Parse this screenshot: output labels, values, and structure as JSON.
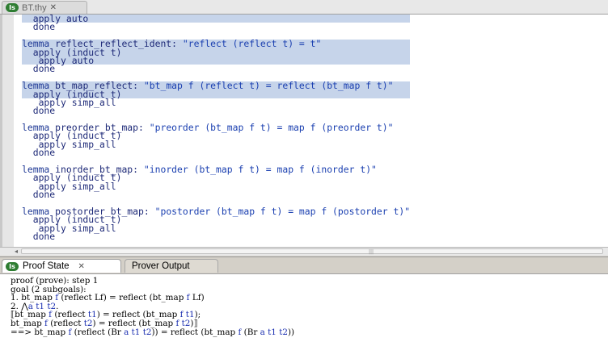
{
  "editor_tab": {
    "title": "BT.thy",
    "close_glyph": "✕",
    "icon": "isabelle-theory-icon"
  },
  "code_lines": [
    {
      "hl": true,
      "parts": [
        [
          "tk",
          "  apply auto"
        ]
      ]
    },
    {
      "hl": false,
      "parts": [
        [
          "tk",
          "  done"
        ]
      ]
    },
    {
      "hl": false,
      "parts": [
        [
          "tk",
          ""
        ]
      ]
    },
    {
      "hl": true,
      "parts": [
        [
          "kw",
          "lemma"
        ],
        [
          "tk",
          " reflect_reflect_ident: "
        ],
        [
          "str",
          "\"reflect (reflect t) = t\""
        ]
      ]
    },
    {
      "hl": true,
      "parts": [
        [
          "tk",
          "  apply (induct t)"
        ]
      ]
    },
    {
      "hl": true,
      "parts": [
        [
          "tk",
          "   apply auto"
        ]
      ]
    },
    {
      "hl": false,
      "parts": [
        [
          "tk",
          "  done"
        ]
      ]
    },
    {
      "hl": false,
      "parts": [
        [
          "tk",
          ""
        ]
      ]
    },
    {
      "hl": true,
      "parts": [
        [
          "kw",
          "lemma"
        ],
        [
          "tk",
          " bt_map_reflect: "
        ],
        [
          "str",
          "\"bt_map f (reflect t) = reflect (bt_map f t)\""
        ]
      ]
    },
    {
      "hl": true,
      "parts": [
        [
          "tk",
          "  apply (induct t)"
        ]
      ]
    },
    {
      "hl": false,
      "parts": [
        [
          "tk",
          "   apply simp_all"
        ]
      ]
    },
    {
      "hl": false,
      "parts": [
        [
          "tk",
          "  done"
        ]
      ]
    },
    {
      "hl": false,
      "parts": [
        [
          "tk",
          ""
        ]
      ]
    },
    {
      "hl": false,
      "parts": [
        [
          "kw",
          "lemma"
        ],
        [
          "tk",
          " preorder_bt_map: "
        ],
        [
          "str",
          "\"preorder (bt_map f t) = map f (preorder t)\""
        ]
      ]
    },
    {
      "hl": false,
      "parts": [
        [
          "tk",
          "  apply (induct t)"
        ]
      ]
    },
    {
      "hl": false,
      "parts": [
        [
          "tk",
          "   apply simp_all"
        ]
      ]
    },
    {
      "hl": false,
      "parts": [
        [
          "tk",
          "  done"
        ]
      ]
    },
    {
      "hl": false,
      "parts": [
        [
          "tk",
          ""
        ]
      ]
    },
    {
      "hl": false,
      "parts": [
        [
          "kw",
          "lemma"
        ],
        [
          "tk",
          " inorder_bt_map: "
        ],
        [
          "str",
          "\"inorder (bt_map f t) = map f (inorder t)\""
        ]
      ]
    },
    {
      "hl": false,
      "parts": [
        [
          "tk",
          "  apply (induct t)"
        ]
      ]
    },
    {
      "hl": false,
      "parts": [
        [
          "tk",
          "   apply simp_all"
        ]
      ]
    },
    {
      "hl": false,
      "parts": [
        [
          "tk",
          "  done"
        ]
      ]
    },
    {
      "hl": false,
      "parts": [
        [
          "tk",
          ""
        ]
      ]
    },
    {
      "hl": false,
      "parts": [
        [
          "kw",
          "lemma"
        ],
        [
          "tk",
          " postorder_bt_map: "
        ],
        [
          "str",
          "\"postorder (bt_map f t) = map f (postorder t)\""
        ]
      ]
    },
    {
      "hl": false,
      "parts": [
        [
          "tk",
          "  apply (induct t)"
        ]
      ]
    },
    {
      "hl": false,
      "parts": [
        [
          "tk",
          "   apply simp_all"
        ]
      ]
    },
    {
      "hl": false,
      "parts": [
        [
          "tk",
          "  done"
        ]
      ]
    }
  ],
  "bottom_tabs": {
    "proof_state": {
      "label": "Proof State",
      "close_glyph": "✕",
      "icon": "isabelle-proof-icon"
    },
    "prover_output": {
      "label": "Prover Output"
    }
  },
  "proof_output": [
    [
      [
        "",
        "proof (prove): step 1"
      ]
    ],
    [
      [
        "",
        "goal (2 subgoals):"
      ]
    ],
    [
      [
        "",
        "1. bt_map "
      ],
      [
        "b",
        "f"
      ],
      [
        "",
        " (reflect Lf) = reflect (bt_map "
      ],
      [
        "b",
        "f"
      ],
      [
        "",
        " Lf)"
      ]
    ],
    [
      [
        "",
        "2. ⋀"
      ],
      [
        "b",
        "a t1 t2"
      ],
      [
        "",
        "."
      ]
    ],
    [
      [
        "",
        "⟦bt_map "
      ],
      [
        "b",
        "f"
      ],
      [
        "",
        " (reflect "
      ],
      [
        "b",
        "t1"
      ],
      [
        "",
        ") = reflect (bt_map "
      ],
      [
        "b",
        "f t1"
      ],
      [
        "",
        ");"
      ]
    ],
    [
      [
        "",
        "bt_map "
      ],
      [
        "b",
        "f"
      ],
      [
        "",
        " (reflect "
      ],
      [
        "b",
        "t2"
      ],
      [
        "",
        ") = reflect (bt_map "
      ],
      [
        "b",
        "f t2"
      ],
      [
        "",
        ")⟧"
      ]
    ],
    [
      [
        "",
        "==> bt_map "
      ],
      [
        "b",
        "f"
      ],
      [
        "",
        " (reflect (Br "
      ],
      [
        "b",
        "a t1 t2"
      ],
      [
        "",
        ")) = reflect (bt_map "
      ],
      [
        "b",
        "f"
      ],
      [
        "",
        " (Br "
      ],
      [
        "b",
        "a t1 t2"
      ],
      [
        "",
        "))"
      ]
    ]
  ],
  "colors": {
    "keyword": "#203a96",
    "string": "#1a3fb0",
    "highlight": "#c6d4ea",
    "bound_var": "#1a2eb0"
  }
}
